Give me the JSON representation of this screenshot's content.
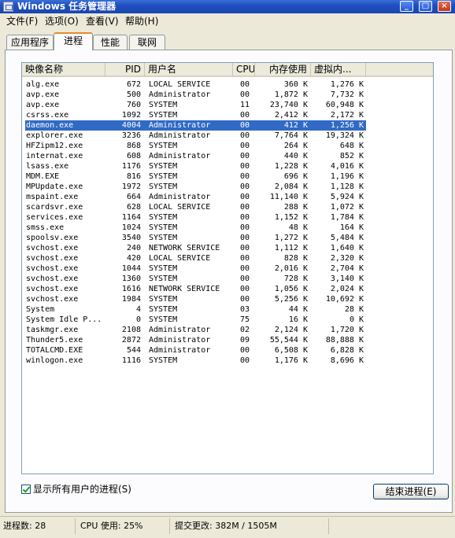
{
  "window": {
    "title": "Windows 任务管理器",
    "minimize_glyph": "_",
    "maximize_glyph": "□",
    "close_glyph": "×"
  },
  "menu": [
    "文件(F)",
    "选项(O)",
    "查看(V)",
    "帮助(H)"
  ],
  "tabs": [
    "应用程序",
    "进程",
    "性能",
    "联网"
  ],
  "active_tab": 1,
  "columns": [
    "映像名称",
    "PID",
    "用户名",
    "CPU",
    "内存使用",
    "虚拟内..."
  ],
  "processes": [
    [
      "alg.exe",
      "672",
      "LOCAL SERVICE",
      "00",
      "360 K",
      "1,276 K"
    ],
    [
      "avp.exe",
      "500",
      "Administrator",
      "00",
      "1,872 K",
      "7,732 K"
    ],
    [
      "avp.exe",
      "760",
      "SYSTEM",
      "11",
      "23,740 K",
      "60,948 K"
    ],
    [
      "csrss.exe",
      "1092",
      "SYSTEM",
      "00",
      "2,412 K",
      "2,172 K"
    ],
    [
      "daemon.exe",
      "4004",
      "Administrator",
      "00",
      "412 K",
      "1,256 K"
    ],
    [
      "explorer.exe",
      "3236",
      "Administrator",
      "00",
      "7,764 K",
      "19,324 K"
    ],
    [
      "HFZipm12.exe",
      "868",
      "SYSTEM",
      "00",
      "264 K",
      "648 K"
    ],
    [
      "internat.exe",
      "608",
      "Administrator",
      "00",
      "440 K",
      "852 K"
    ],
    [
      "lsass.exe",
      "1176",
      "SYSTEM",
      "00",
      "1,228 K",
      "4,016 K"
    ],
    [
      "MDM.EXE",
      "816",
      "SYSTEM",
      "00",
      "696 K",
      "1,196 K"
    ],
    [
      "MPUpdate.exe",
      "1972",
      "SYSTEM",
      "00",
      "2,084 K",
      "1,128 K"
    ],
    [
      "mspaint.exe",
      "664",
      "Administrator",
      "00",
      "11,140 K",
      "5,924 K"
    ],
    [
      "scardsvr.exe",
      "628",
      "LOCAL SERVICE",
      "00",
      "288 K",
      "1,072 K"
    ],
    [
      "services.exe",
      "1164",
      "SYSTEM",
      "00",
      "1,152 K",
      "1,784 K"
    ],
    [
      "smss.exe",
      "1024",
      "SYSTEM",
      "00",
      "48 K",
      "164 K"
    ],
    [
      "spoolsv.exe",
      "3540",
      "SYSTEM",
      "00",
      "1,272 K",
      "5,484 K"
    ],
    [
      "svchost.exe",
      "240",
      "NETWORK SERVICE",
      "00",
      "1,112 K",
      "1,640 K"
    ],
    [
      "svchost.exe",
      "420",
      "LOCAL SERVICE",
      "00",
      "828 K",
      "2,320 K"
    ],
    [
      "svchost.exe",
      "1044",
      "SYSTEM",
      "00",
      "2,016 K",
      "2,704 K"
    ],
    [
      "svchost.exe",
      "1360",
      "SYSTEM",
      "00",
      "728 K",
      "3,140 K"
    ],
    [
      "svchost.exe",
      "1616",
      "NETWORK SERVICE",
      "00",
      "1,056 K",
      "2,024 K"
    ],
    [
      "svchost.exe",
      "1984",
      "SYSTEM",
      "00",
      "5,256 K",
      "10,692 K"
    ],
    [
      "System",
      "4",
      "SYSTEM",
      "03",
      "44 K",
      "28 K"
    ],
    [
      "System Idle P...",
      "0",
      "SYSTEM",
      "75",
      "16 K",
      "0 K"
    ],
    [
      "taskmgr.exe",
      "2108",
      "Administrator",
      "02",
      "2,124 K",
      "1,720 K"
    ],
    [
      "Thunder5.exe",
      "2872",
      "Administrator",
      "09",
      "55,544 K",
      "88,888 K"
    ],
    [
      "TOTALCMD.EXE",
      "544",
      "Administrator",
      "00",
      "6,508 K",
      "6,828 K"
    ],
    [
      "winlogon.exe",
      "1116",
      "SYSTEM",
      "00",
      "1,176 K",
      "8,696 K"
    ]
  ],
  "selected_process": "daemon.exe",
  "show_all_users": {
    "label": "显示所有用户的进程(S)",
    "checked": true
  },
  "end_process_label": "结束进程(E)",
  "status": {
    "process_count": "进程数: 28",
    "cpu_usage": "CPU 使用: 25%",
    "commit_charge": "提交更改: 382M / 1505M"
  }
}
